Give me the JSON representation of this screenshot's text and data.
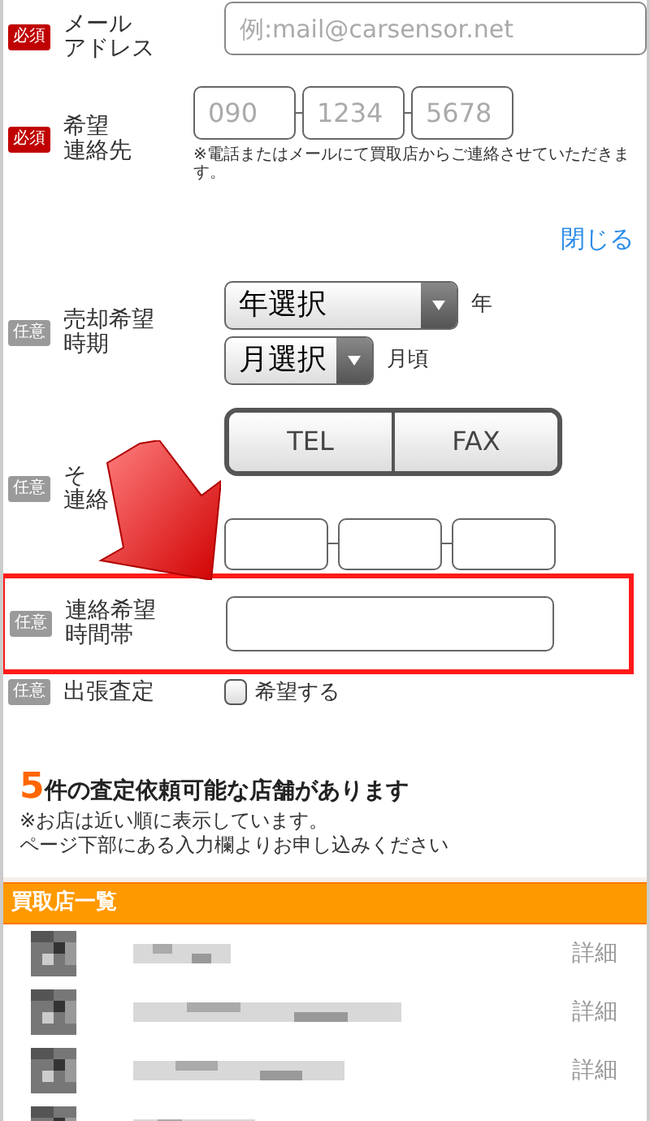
{
  "form": [
    {
      "badge": {
        "text": "必須",
        "kind": "required"
      },
      "label": [
        "メール",
        "アドレス"
      ],
      "placeholder": "例:mail@carsensor.net"
    },
    {
      "badge": {
        "text": "必須",
        "kind": "required"
      },
      "label": [
        "希望",
        "連絡先"
      ],
      "placeholders": [
        "090",
        "1234",
        "5678"
      ],
      "note": "※電話またはメールにて買取店からご連絡させていただきます。"
    }
  ],
  "close_link": "閉じる",
  "optional_fields": [
    {
      "kind": "period",
      "badge": {
        "text": "任意",
        "kind": "optional"
      },
      "label": [
        "売却希望",
        "時期"
      ],
      "selects": [
        {
          "value": "年選択",
          "suffix": "年"
        },
        {
          "value": "月選択",
          "suffix": "月頃"
        }
      ]
    },
    {
      "kind": "other_contact",
      "badge": {
        "text": "任意",
        "kind": "optional"
      },
      "label": [
        "そ",
        "連絡"
      ],
      "toggle": [
        {
          "label": "TEL",
          "selected": false
        },
        {
          "label": "FAX",
          "selected": false
        }
      ]
    },
    {
      "kind": "time",
      "badge": {
        "text": "任意",
        "kind": "optional"
      },
      "label": [
        "連絡希望",
        "時間帯"
      ],
      "highlighted": true
    },
    {
      "kind": "visit",
      "badge": {
        "text": "任意",
        "kind": "optional"
      },
      "label": [
        "出張査定"
      ],
      "checkbox": {
        "label": "希望する",
        "checked": false
      }
    }
  ],
  "summary": {
    "count": "5",
    "heading": "件の査定依頼可能な店舗があります",
    "notes": [
      "※お店は近い順に表示しています。",
      "ページ下部にある入力欄よりお申し込みください"
    ]
  },
  "shop_list": {
    "title": "買取店一覧",
    "rows": [
      {
        "detail": "詳細"
      },
      {
        "detail": "詳細"
      },
      {
        "detail": "詳細"
      },
      {}
    ]
  }
}
